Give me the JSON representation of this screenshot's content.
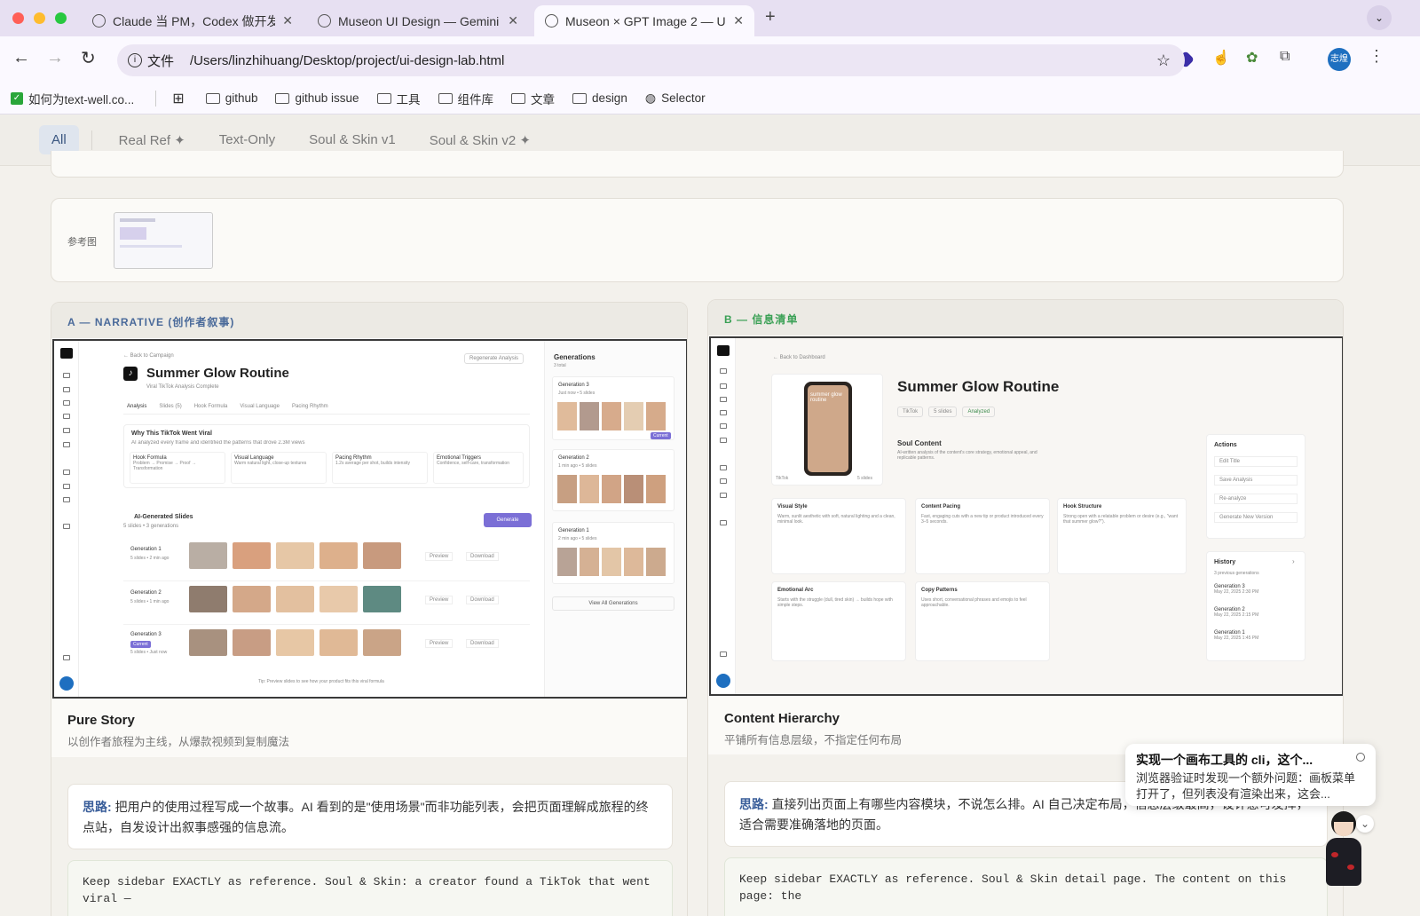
{
  "tabs": [
    {
      "title": "Claude 当 PM，Codex 做开发"
    },
    {
      "title": "Museon UI Design — Gemini I"
    },
    {
      "title": "Museon × GPT Image 2 — UI"
    }
  ],
  "address": {
    "scheme_label": "文件",
    "url": "/Users/linzhihuang/Desktop/project/ui-design-lab.html"
  },
  "profile_label": "志煌",
  "bookmarks": [
    {
      "label": "如何为text-well.co..."
    },
    {
      "label": "github"
    },
    {
      "label": "github issue"
    },
    {
      "label": "工具"
    },
    {
      "label": "组件库"
    },
    {
      "label": "文章"
    },
    {
      "label": "design"
    },
    {
      "label": "Selector"
    }
  ],
  "filters": [
    "All",
    "Real Ref ✦",
    "Text-Only",
    "Soul & Skin v1",
    "Soul & Skin v2 ✦"
  ],
  "reference": {
    "label": "参考图"
  },
  "variant_a": {
    "tag": "A — NARRATIVE (创作者叙事)",
    "name": "Pure Story",
    "desc": "以创作者旅程为主线，从爆款视频到复制魔法",
    "note_label": "思路:",
    "note": "把用户的使用过程写成一个故事。AI 看到的是\"使用场景\"而非功能列表，会把页面理解成旅程的终点站，自发设计出叙事感强的信息流。",
    "prompt": "Keep sidebar EXACTLY as reference. Soul & Skin: a creator found a TikTok that went viral —",
    "mock": {
      "back": "← Back to Campaign",
      "regen": "Regenerate Analysis",
      "title": "Summer Glow Routine",
      "subtitle": "Viral TikTok Analysis Complete",
      "tabs": [
        "Analysis",
        "Slides (5)",
        "Hook Formula",
        "Visual Language",
        "Pacing Rhythm"
      ],
      "why_title": "Why This TikTok Went Viral",
      "why_sub": "AI analyzed every frame and identified the patterns that drove 2.3M views",
      "cards": [
        {
          "title": "Hook Formula",
          "text": "Problem → Promise → Proof → Transformation"
        },
        {
          "title": "Visual Language",
          "text": "Warm natural light, close-up textures"
        },
        {
          "title": "Pacing Rhythm",
          "text": "1.2s average per shot, builds intensity"
        },
        {
          "title": "Emotional Triggers",
          "text": "Confidence, self-care, transformation"
        }
      ],
      "slides_title": "AI-Generated Slides",
      "slides_sub": "5 slides • 3 generations",
      "generate": "Generate",
      "rows": [
        {
          "name": "Generation 1",
          "meta": "5 slides • 2 min ago"
        },
        {
          "name": "Generation 2",
          "meta": "5 slides • 1 min ago"
        },
        {
          "name": "Generation 3",
          "meta": "5 slides • Just now"
        }
      ],
      "preview": "Preview",
      "download": "Download",
      "current": "Current",
      "tip": "Tip: Preview slides to see how your product fits this viral formula",
      "gens_title": "Generations",
      "gens_sub": "3 total",
      "gens": [
        {
          "name": "Generation 3",
          "meta": "Just now • 5 slides"
        },
        {
          "name": "Generation 2",
          "meta": "1 min ago • 5 slides"
        },
        {
          "name": "Generation 1",
          "meta": "2 min ago • 5 slides"
        }
      ],
      "view_all": "View All Generations"
    }
  },
  "variant_b": {
    "tag": "B — 信息清单",
    "name": "Content Hierarchy",
    "desc": "平铺所有信息层级，不指定任何布局",
    "note_label": "思路:",
    "note": "直接列出页面上有哪些内容模块，不说怎么排。AI 自己决定布局，信息层级最高，设计感可发挥，适合需要准确落地的页面。",
    "prompt": "Keep sidebar EXACTLY as reference. Soul & Skin detail page. The content on this page: the",
    "mock": {
      "back": "Back to Dashboard",
      "title": "Summer Glow Routine",
      "chips": [
        "TikTok",
        "5 slides",
        "Analyzed"
      ],
      "phone_text": "summer glow routine",
      "phone_caption": "TikTok",
      "phone_slides": "5 slides",
      "soul_title": "Soul Content",
      "soul_sub": "AI-written analysis of the content's core strategy, emotional appeal, and replicable patterns.",
      "cards": [
        {
          "title": "Visual Style",
          "text": "Warm, sunlit aesthetic with soft, natural lighting and a clean, minimal look."
        },
        {
          "title": "Content Pacing",
          "text": "Fast, engaging cuts with a new tip or product introduced every 3–5 seconds."
        },
        {
          "title": "Hook Structure",
          "text": "Strong open with a relatable problem or desire (e.g., \"want that summer glow?\")."
        },
        {
          "title": "Emotional Arc",
          "text": "Starts with the struggle (dull, tired skin) → builds hope with simple steps."
        },
        {
          "title": "Copy Patterns",
          "text": "Uses short, conversational phrases and emojis to feel approachable."
        }
      ],
      "actions_title": "Actions",
      "actions": [
        "Edit Title",
        "Save Analysis",
        "Re-analyze",
        "Generate New Version"
      ],
      "history_title": "History",
      "history_sub": "3 previous generations",
      "history": [
        {
          "name": "Generation 3",
          "date": "May 22, 2025 2:30 PM"
        },
        {
          "name": "Generation 2",
          "date": "May 22, 2025 2:15 PM"
        },
        {
          "name": "Generation 1",
          "date": "May 22, 2025 1:45 PM"
        }
      ]
    }
  },
  "toast": {
    "title": "实现一个画布工具的 cli，这个...",
    "body": "浏览器验证时发现一个额外问题：画板菜单打开了，但列表没有渲染出来，这会..."
  }
}
